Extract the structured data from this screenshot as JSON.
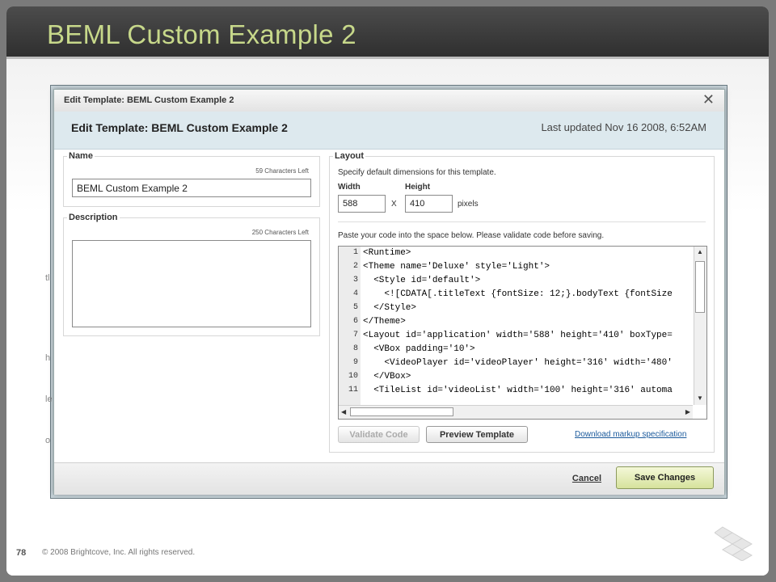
{
  "slide": {
    "title": "BEML Custom Example 2",
    "page_number": "78",
    "copyright": "© 2008 Brightcove, Inc. All rights reserved."
  },
  "background": {
    "partial_letters": [
      "tl",
      "h",
      "le",
      "o"
    ]
  },
  "dialog": {
    "window_title": "Edit Template: BEML Custom Example 2",
    "close_glyph": "✕",
    "header_title": "Edit Template: BEML Custom Example 2",
    "last_updated": "Last updated Nov 16 2008, 6:52AM",
    "name": {
      "legend": "Name",
      "chars_left": "59 Characters Left",
      "value": "BEML Custom Example 2"
    },
    "description": {
      "legend": "Description",
      "chars_left": "250 Characters Left",
      "value": ""
    },
    "layout": {
      "legend": "Layout",
      "instruction": "Specify default dimensions for this template.",
      "width_label": "Width",
      "height_label": "Height",
      "width_value": "588",
      "height_value": "410",
      "times_sign": "X",
      "unit": "pixels",
      "code_instruction": "Paste your code into the space below. Please validate code before saving.",
      "code_lines": [
        {
          "num": "1",
          "text": "<Runtime>"
        },
        {
          "num": "2",
          "text": "<Theme name='Deluxe' style='Light'>"
        },
        {
          "num": "3",
          "text": "  <Style id='default'>"
        },
        {
          "num": "4",
          "text": "    <![CDATA[.titleText {fontSize: 12;}.bodyText {fontSize"
        },
        {
          "num": "5",
          "text": "  </Style>"
        },
        {
          "num": "6",
          "text": "</Theme>"
        },
        {
          "num": "7",
          "text": "<Layout id='application' width='588' height='410' boxType="
        },
        {
          "num": "8",
          "text": "  <VBox padding='10'>"
        },
        {
          "num": "9",
          "text": "    <VideoPlayer id='videoPlayer' height='316' width='480'"
        },
        {
          "num": "10",
          "text": "  </VBox>"
        },
        {
          "num": "11",
          "text": "  <TileList id='videoList' width='100' height='316' automa"
        }
      ],
      "validate_button": "Validate Code",
      "preview_button": "Preview Template",
      "download_link": "Download markup specification"
    },
    "footer": {
      "cancel": "Cancel",
      "save": "Save Changes"
    }
  },
  "colors": {
    "title_accent": "#c7d88a",
    "dialog_header_bg": "#dde9ee",
    "save_button": "#d6e29c",
    "link": "#1b5a9c"
  }
}
